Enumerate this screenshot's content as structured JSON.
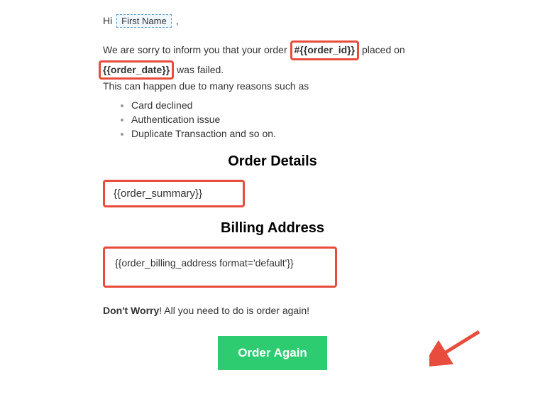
{
  "greeting": {
    "prefix": "Hi",
    "chip": "First Name",
    "suffix": ","
  },
  "intro": {
    "part1": "We are sorry to inform you that your order ",
    "order_id": "#{{order_id}}",
    "part2": " placed on ",
    "order_date": "{{order_date}}",
    "part3": " was failed.",
    "line2": "This can happen due to many reasons such as"
  },
  "reasons": [
    "Card declined",
    "Authentication issue",
    "Duplicate Transaction and so on."
  ],
  "sections": {
    "order_details_heading": "Order Details",
    "order_summary_var": "{{order_summary}}",
    "billing_heading": "Billing Address",
    "billing_var": "{{order_billing_address format='default'}}"
  },
  "footer": {
    "dont_worry_bold": "Don't Worry",
    "dont_worry_rest": "! All you need to do is order again!",
    "button_label": "Order Again"
  },
  "colors": {
    "highlight_border": "#e74c3c",
    "button_bg": "#2ecc71",
    "arrow": "#e74c3c"
  }
}
